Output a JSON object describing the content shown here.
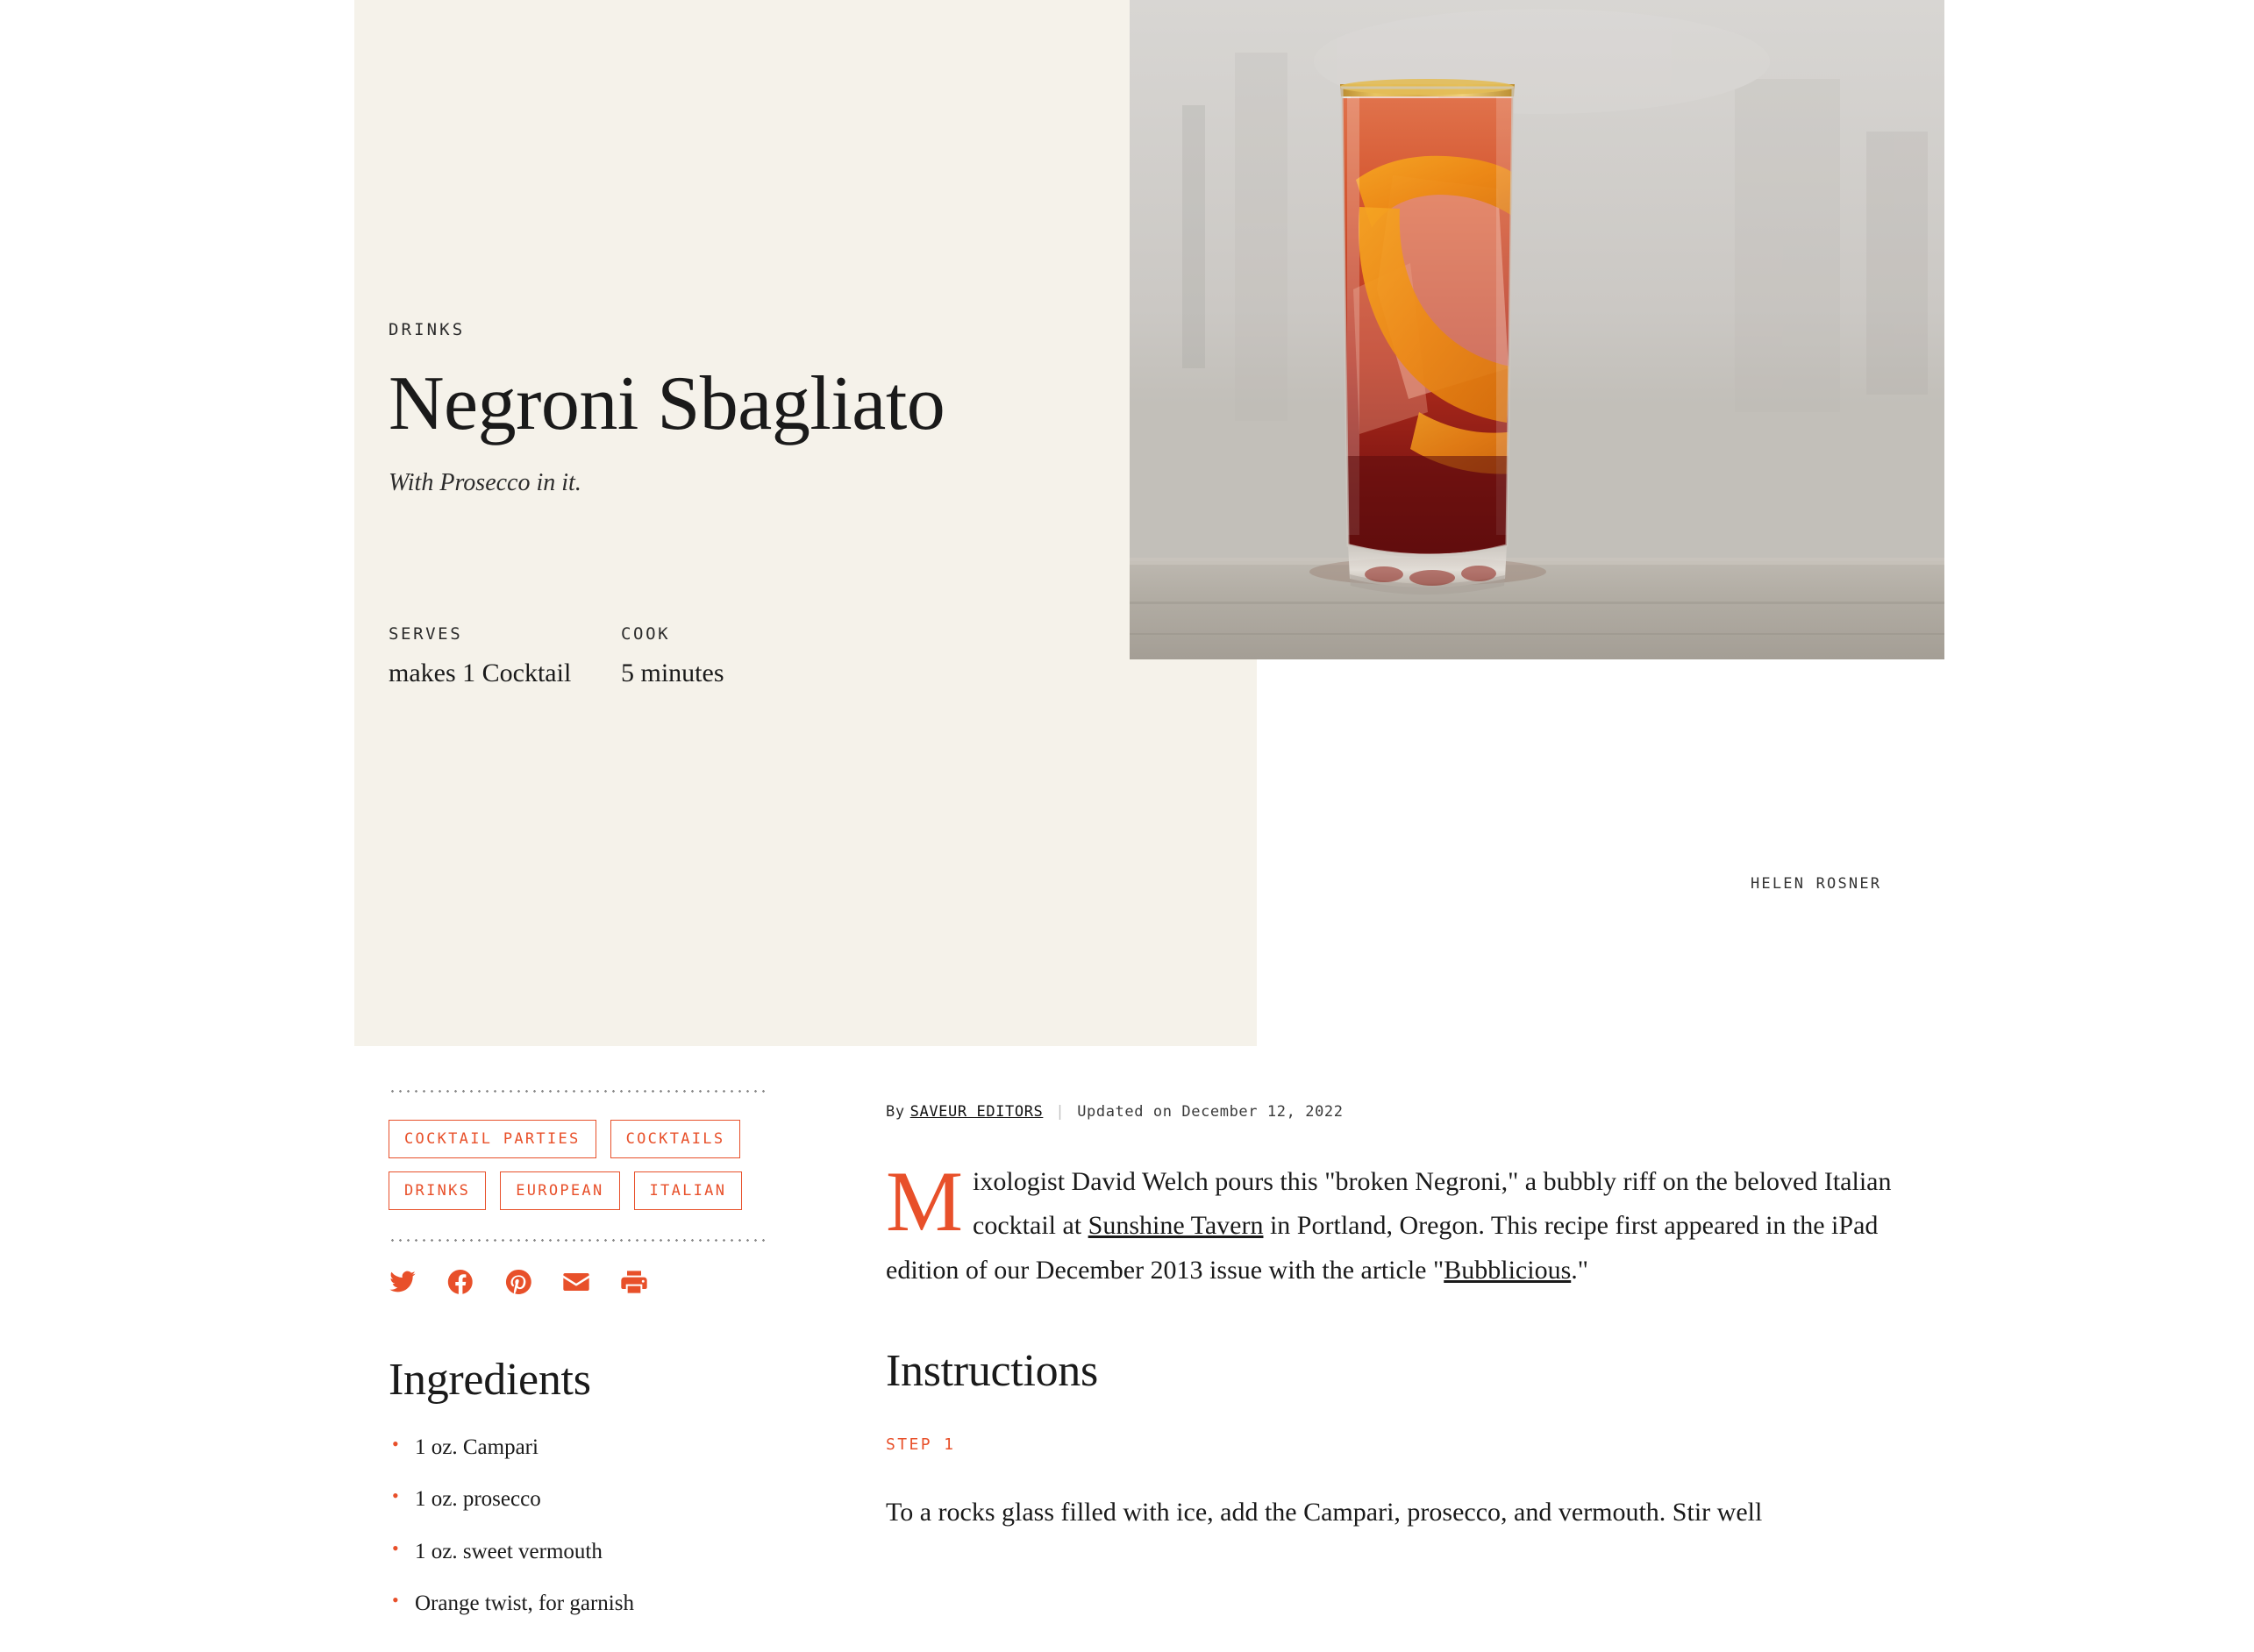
{
  "hero": {
    "eyebrow": "DRINKS",
    "title": "Negroni Sbagliato",
    "dek": "With Prosecco in it.",
    "serves_label": "SERVES",
    "serves_value": "makes 1 Cocktail",
    "cook_label": "COOK",
    "cook_value": "5 minutes",
    "photo_credit": "HELEN ROSNER",
    "background_color": "#f5f2ea"
  },
  "accent_color": "#e8502a",
  "tags": [
    {
      "label": "COCKTAIL PARTIES"
    },
    {
      "label": "COCKTAILS"
    },
    {
      "label": "DRINKS"
    },
    {
      "label": "EUROPEAN"
    },
    {
      "label": "ITALIAN"
    }
  ],
  "socials": [
    {
      "name": "twitter-icon"
    },
    {
      "name": "facebook-icon"
    },
    {
      "name": "pinterest-icon"
    },
    {
      "name": "email-icon"
    },
    {
      "name": "print-icon"
    }
  ],
  "ingredients": {
    "heading": "Ingredients",
    "items": [
      "1 oz. Campari",
      "1 oz. prosecco",
      "1 oz. sweet vermouth",
      "Orange twist, for garnish"
    ]
  },
  "byline": {
    "by_prefix": "By",
    "author": "SAVEUR EDITORS",
    "separator": "|",
    "updated": "Updated on December 12, 2022"
  },
  "lede": {
    "dropcap": "M",
    "part1": "ixologist David Welch pours this \"broken Negroni,\" a bubbly riff on the beloved Italian cocktail at ",
    "link1": "Sunshine Tavern",
    "part2": " in Portland, Oregon. This recipe first appeared in the iPad edition of our December 2013 issue with the article \"",
    "link2": "Bubblicious",
    "part3": ".\""
  },
  "instructions": {
    "heading": "Instructions",
    "step_label": "STEP 1",
    "step_text": "To a rocks glass filled with ice, add the Campari, prosecco, and vermouth. Stir well"
  }
}
